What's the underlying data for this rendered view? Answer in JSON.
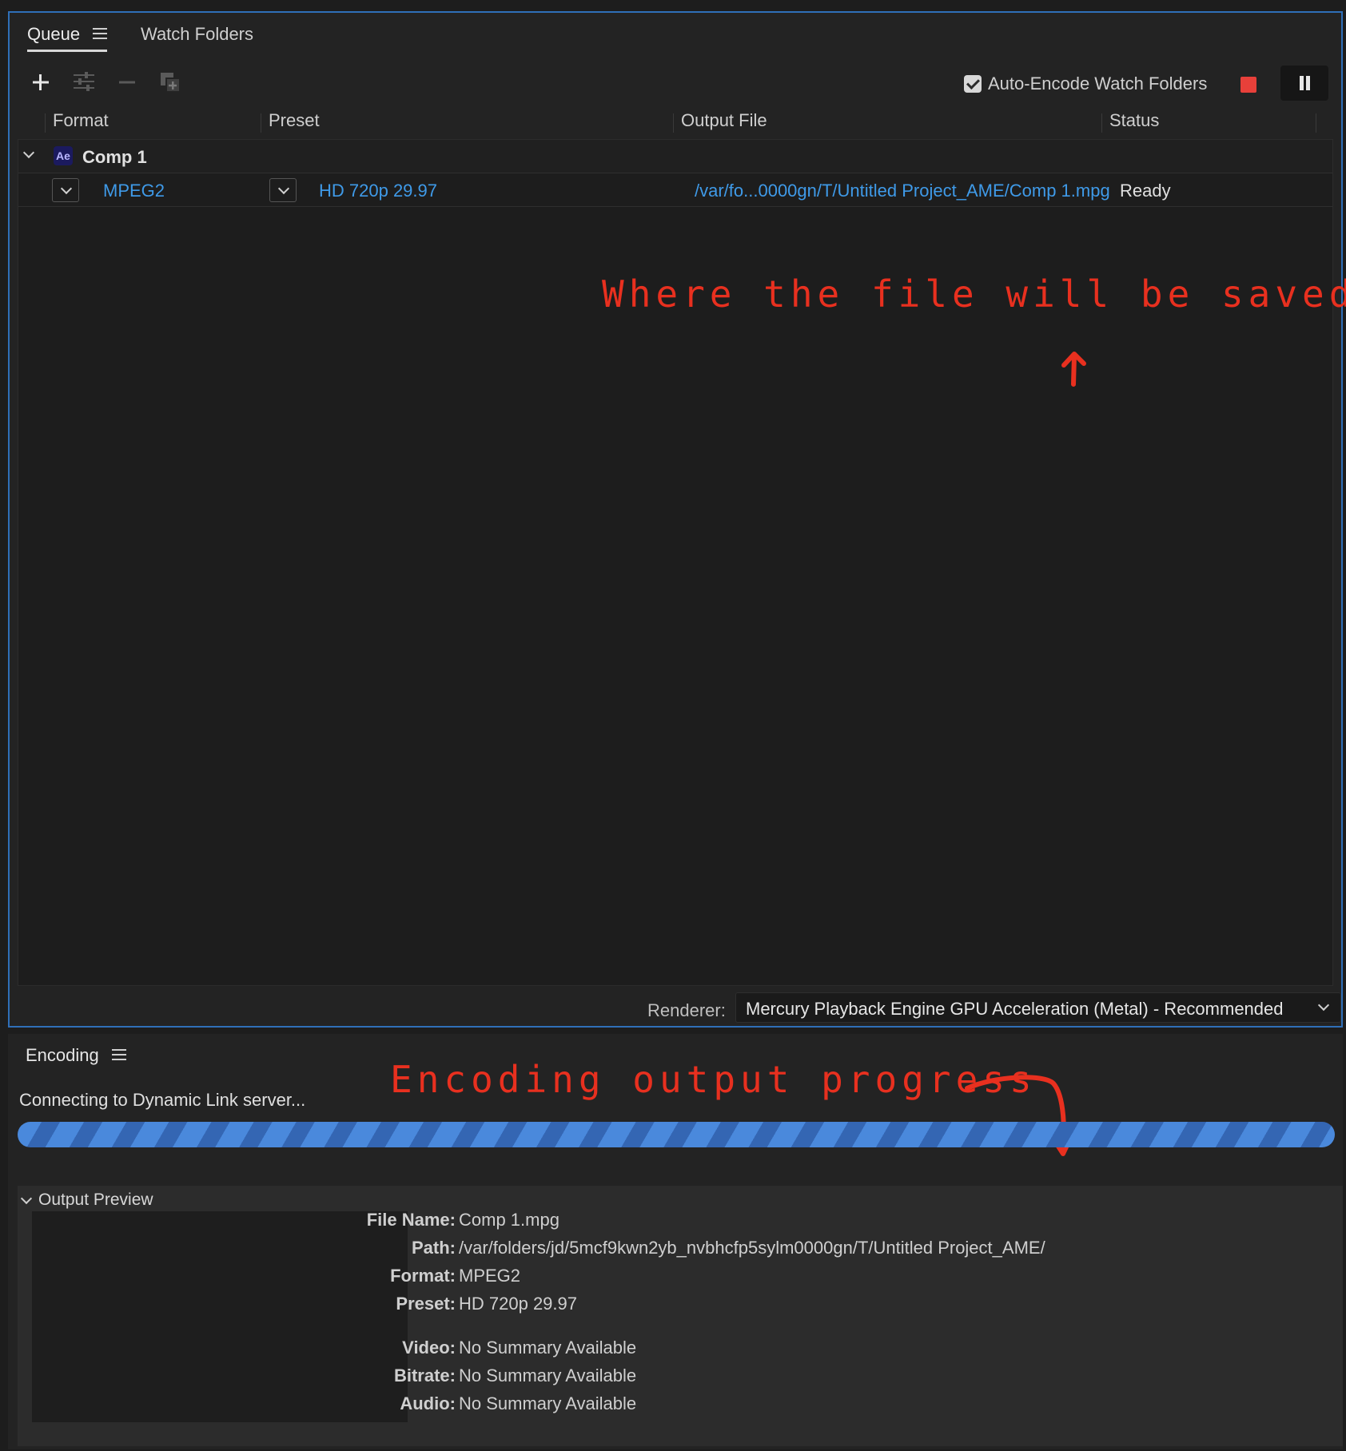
{
  "queue": {
    "tabs": {
      "queue": "Queue",
      "watch_folders": "Watch Folders"
    },
    "auto_encode_label": "Auto-Encode Watch Folders",
    "columns": {
      "format": "Format",
      "preset": "Preset",
      "output_file": "Output File",
      "status": "Status"
    },
    "comp": {
      "badge": "Ae",
      "name": "Comp 1"
    },
    "item": {
      "format": "MPEG2",
      "preset": "HD 720p 29.97",
      "output_file": "/var/fo...0000gn/T/Untitled Project_AME/Comp 1.mpg",
      "status": "Ready"
    },
    "annotation": "Where the file will be saved",
    "renderer_label": "Renderer:",
    "renderer_value": "Mercury Playback Engine GPU Acceleration (Metal) - Recommended"
  },
  "encoding": {
    "tab": "Encoding",
    "status": "Connecting to Dynamic Link server...",
    "annotation": "Encoding output progress",
    "progress_fraction": 1.0,
    "preview_toggle": "Output Preview",
    "info": {
      "file_name_label": "File Name:",
      "file_name": "Comp 1.mpg",
      "path_label": "Path:",
      "path": "/var/folders/jd/5mcf9kwn2yb_nvbhcfp5sylm0000gn/T/Untitled Project_AME/",
      "format_label": "Format:",
      "format": "MPEG2",
      "preset_label": "Preset:",
      "preset": "HD 720p 29.97",
      "video_label": "Video:",
      "video": "No Summary Available",
      "bitrate_label": "Bitrate:",
      "bitrate": "No Summary Available",
      "audio_label": "Audio:",
      "audio": "No Summary Available"
    }
  },
  "colors": {
    "accent": "#2f6fb8",
    "link": "#3f9ae8",
    "annotation": "#e8301f",
    "stop": "#e8403a",
    "progress": "#4a89dc"
  },
  "icons": {
    "add": "plus-icon",
    "settings": "adjust-settings-icon",
    "remove": "minus-icon",
    "duplicate": "duplicate-icon",
    "stop": "stop-icon",
    "pause": "pause-icon"
  }
}
